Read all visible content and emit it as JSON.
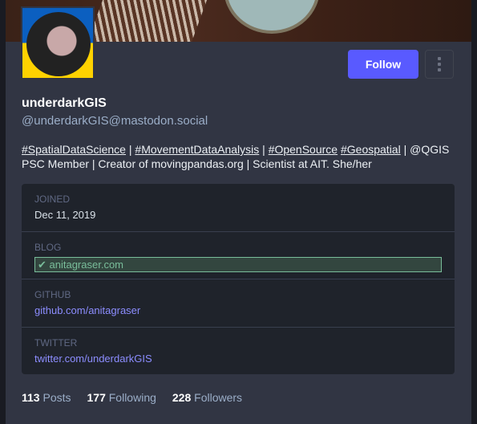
{
  "profile": {
    "display_name": "underdarkGIS",
    "handle": "@underdarkGIS@mastodon.social",
    "follow_label": "Follow"
  },
  "bio": {
    "tags": [
      "#SpatialDataScience",
      "#MovementDataAnalysis",
      "#OpenSource",
      "#Geospatial"
    ],
    "sep": " | ",
    "text": " | @QGIS PSC Member | Creator of movingpandas.org | Scientist at AIT. She/her"
  },
  "fields": [
    {
      "label": "Joined",
      "value": "Dec 11, 2019"
    },
    {
      "label": "Blog",
      "value": "anitagraser.com"
    },
    {
      "label": "GitHub",
      "value": "github.com/anitagraser"
    },
    {
      "label": "Twitter",
      "value": "twitter.com/underdarkGIS"
    }
  ],
  "stats": {
    "posts": "113",
    "posts_label": "Posts",
    "following": "177",
    "following_label": "Following",
    "followers": "228",
    "followers_label": "Followers"
  },
  "colors": {
    "accent": "#595aff",
    "verified": "#79bd9a"
  }
}
